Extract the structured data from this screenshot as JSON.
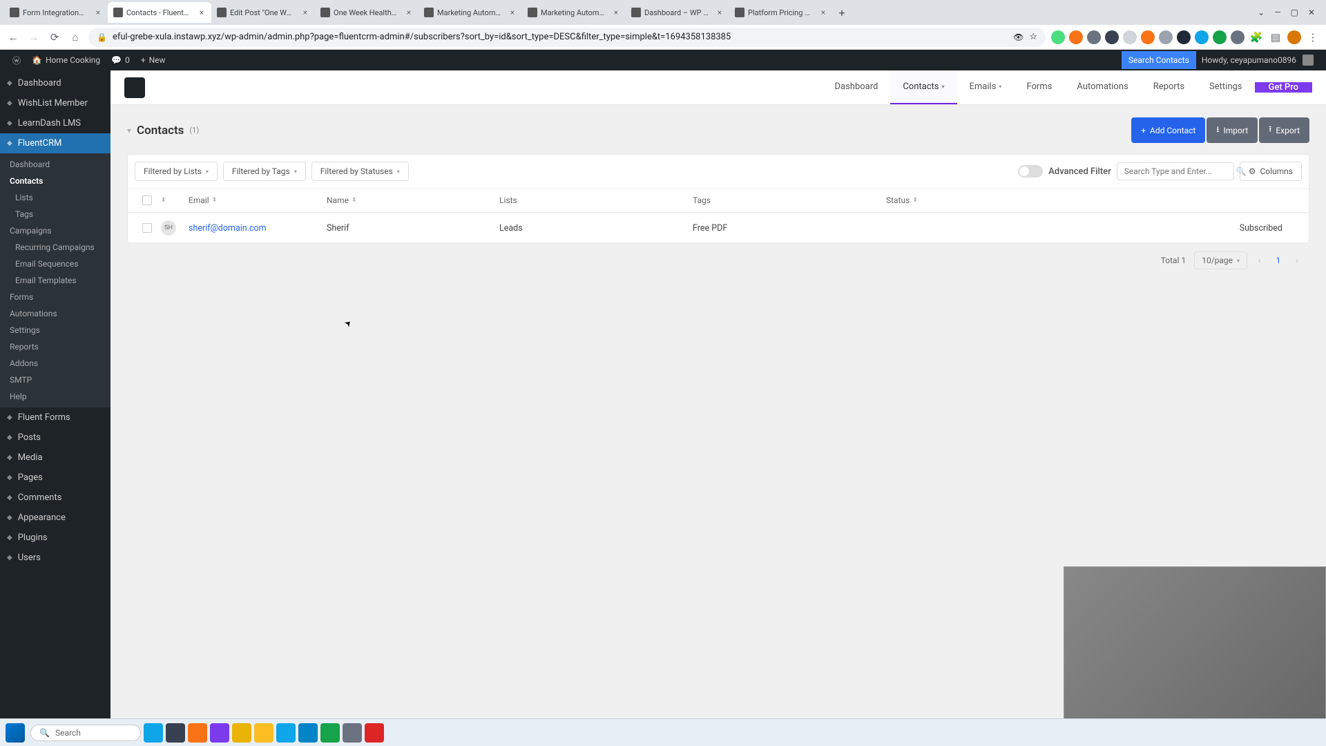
{
  "browser": {
    "tabs": [
      {
        "title": "Form Integrations – Flue",
        "active": false
      },
      {
        "title": "Contacts - FluentCRM",
        "active": true
      },
      {
        "title": "Edit Post \"One Week He",
        "active": false
      },
      {
        "title": "One Week Healthy & B",
        "active": false
      },
      {
        "title": "Marketing Automation F",
        "active": false
      },
      {
        "title": "Marketing Automation F",
        "active": false
      },
      {
        "title": "Dashboard – WP Manag",
        "active": false
      },
      {
        "title": "Platform Pricing & Feat",
        "active": false
      }
    ],
    "url": "eful-grebe-xula.instawp.xyz/wp-admin/admin.php?page=fluentcrm-admin#/subscribers?sort_by=id&sort_type=DESC&filter_type=simple&t=1694358138385"
  },
  "wp_bar": {
    "site": "Home Cooking",
    "comments": "0",
    "new": "New",
    "search_contacts": "Search Contacts",
    "howdy": "Howdy, ceyapumano0896"
  },
  "wp_sidebar": {
    "main": [
      "Dashboard",
      "WishList Member",
      "LearnDash LMS",
      "FluentCRM"
    ],
    "fluent_sub": [
      "Dashboard",
      "Contacts",
      "Lists",
      "Tags",
      "Campaigns",
      "Recurring Campaigns",
      "Email Sequences",
      "Email Templates",
      "Forms",
      "Automations",
      "Settings",
      "Reports",
      "Addons",
      "SMTP",
      "Help"
    ],
    "rest": [
      "Fluent Forms",
      "Posts",
      "Media",
      "Pages",
      "Comments",
      "Appearance",
      "Plugins",
      "Users"
    ]
  },
  "fcrm": {
    "nav": [
      "Dashboard",
      "Contacts",
      "Emails",
      "Forms",
      "Automations",
      "Reports",
      "Settings"
    ],
    "getpro": "Get Pro",
    "title": "Contacts",
    "count": "(1)",
    "add_contact": "Add Contact",
    "import": "Import",
    "export": "Export",
    "filters": {
      "lists": "Filtered by Lists",
      "tags": "Filtered by Tags",
      "statuses": "Filtered by Statuses",
      "advanced": "Advanced Filter",
      "search_placeholder": "Search Type and Enter...",
      "columns": "Columns"
    },
    "table": {
      "headers": {
        "email": "Email",
        "name": "Name",
        "lists": "Lists",
        "tags": "Tags",
        "status": "Status"
      },
      "rows": [
        {
          "initials": "SH",
          "email": "sherif@domain.com",
          "name": "Sherif",
          "lists": "Leads",
          "tags": "Free PDF",
          "status": "Subscribed"
        }
      ]
    },
    "pagination": {
      "total": "Total 1",
      "per_page": "10/page",
      "current": "1"
    }
  },
  "taskbar": {
    "search": "Search"
  }
}
